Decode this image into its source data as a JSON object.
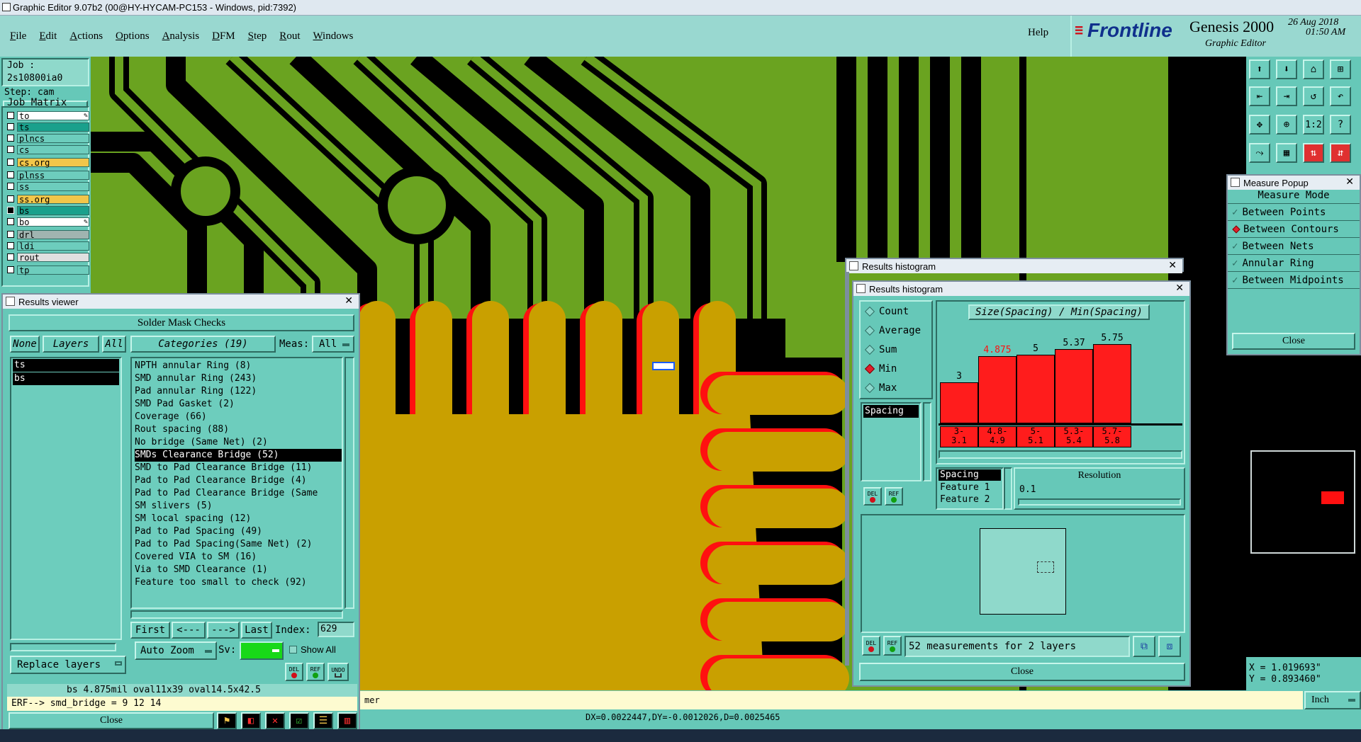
{
  "window_title": "Graphic Editor 9.07b2 (00@HY-HYCAM-PC153 - Windows, pid:7392)",
  "menu": [
    "File",
    "Edit",
    "Actions",
    "Options",
    "Analysis",
    "DFM",
    "Step",
    "Rout",
    "Windows"
  ],
  "help": "Help",
  "brand": {
    "logo": "Frontline",
    "product": "Genesis 2000",
    "subtitle": "Graphic Editor",
    "date": "26 Aug 2018",
    "time": "01:50 AM"
  },
  "job": {
    "job_label": "Job : 2s10800ia0",
    "step_label": "Step: cam",
    "matrix_button": "Job Matrix ..."
  },
  "layers": [
    {
      "name": "to",
      "color": "#ffffff",
      "mark": "✎"
    },
    {
      "name": "ts",
      "color": "#1aa08c",
      "mark": ""
    },
    {
      "name": "plncs",
      "color": "#6dcdbd",
      "mark": ""
    },
    {
      "name": "cs",
      "color": "#6dcdbd",
      "mark": ""
    },
    {
      "name": "cs.org",
      "color": "#f2c64a",
      "mark": ""
    },
    {
      "name": "plnss",
      "color": "#6dcdbd",
      "mark": ""
    },
    {
      "name": "ss",
      "color": "#6dcdbd",
      "mark": ""
    },
    {
      "name": "ss.org",
      "color": "#f2c64a",
      "mark": ""
    },
    {
      "name": "bs",
      "color": "#1aa08c",
      "mark": ""
    },
    {
      "name": "bo",
      "color": "#ffffff",
      "mark": "✎"
    },
    {
      "name": "drl",
      "color": "#a0b4b0",
      "mark": ""
    },
    {
      "name": "ldi",
      "color": "#6dcdbd",
      "mark": ""
    },
    {
      "name": "rout",
      "color": "#e0e0e0",
      "mark": ""
    },
    {
      "name": "tp",
      "color": "#6dcdbd",
      "mark": ""
    }
  ],
  "results_viewer": {
    "title": "Results viewer",
    "header": "Solder Mask Checks",
    "none_btn": "None",
    "layers_btn": "Layers",
    "all_btn": "All",
    "categories_btn": "Categories (19)",
    "meas_label": "Meas:",
    "meas_value": "All",
    "layer_list": [
      "ts",
      "bs"
    ],
    "categories": [
      "NPTH annular Ring (8)",
      "SMD annular Ring (243)",
      "Pad annular Ring (122)",
      "SMD Pad Gasket (2)",
      "Coverage (66)",
      "Rout spacing (88)",
      "No bridge (Same Net) (2)",
      "SMDs Clearance Bridge (52)",
      "SMD to Pad Clearance Bridge (11)",
      "Pad to Pad Clearance Bridge (4)",
      "Pad to Pad Clearance Bridge (Same",
      "SM slivers (5)",
      "SM local spacing (12)",
      "Pad to Pad Spacing (49)",
      "Pad to Pad Spacing(Same Net) (2)",
      "Covered VIA to SM (16)",
      "Via to SMD Clearance (1)",
      "Feature too small to check (92)"
    ],
    "selected_category": "SMDs Clearance Bridge (52)",
    "first": "First",
    "prev": "<---",
    "next": "--->",
    "last": "Last",
    "index_label": "Index:",
    "index_value": "629",
    "auto_zoom": "Auto Zoom",
    "sv_label": "Sv:",
    "show_all": "Show All",
    "replace_layers": "Replace layers",
    "del": "DEL",
    "ref": "REF",
    "undo": "UNDO",
    "status_line": "bs 4.875mil  oval11x39  oval14.5x42.5",
    "erf_line": "ERF--> smd_bridge = 9 12 14",
    "close": "Close"
  },
  "histogram": {
    "back_title": "Results histogram",
    "title": "Results histogram",
    "modes": [
      {
        "label": "Count",
        "on": false
      },
      {
        "label": "Average",
        "on": false
      },
      {
        "label": "Sum",
        "on": false
      },
      {
        "label": "Min",
        "on": true
      },
      {
        "label": "Max",
        "on": false
      }
    ],
    "chart_title": "Size(Spacing) / Min(Spacing)",
    "list_item": "Spacing",
    "attr_list": [
      "Spacing",
      "Feature 1",
      "Feature 2"
    ],
    "resolution_label": "Resolution",
    "resolution_value": "0.1",
    "summary": "52 measurements for 2 layers",
    "close": "Close",
    "del": "DEL",
    "ref": "REF"
  },
  "chart_data": {
    "type": "bar",
    "title": "Size(Spacing) / Min(Spacing)",
    "categories": [
      "3-\n3.1",
      "4.8-\n4.9",
      "5-\n5.1",
      "5.3-\n5.4",
      "5.7-\n5.8"
    ],
    "category_labels": [
      [
        "3-",
        "3.1"
      ],
      [
        "4.8-",
        "4.9"
      ],
      [
        "5-",
        "5.1"
      ],
      [
        "5.3-",
        "5.4"
      ],
      [
        "5.7-",
        "5.8"
      ]
    ],
    "values": [
      3,
      4.875,
      5,
      5.37,
      5.75
    ],
    "value_labels": [
      "3",
      "4.875",
      "5",
      "5.37",
      "5.75"
    ],
    "highlight_index": 1,
    "ylim": [
      0,
      5.75
    ]
  },
  "measure_popup": {
    "title": "Measure Popup",
    "header": "Measure Mode",
    "modes": [
      {
        "label": "Between Points",
        "on": false
      },
      {
        "label": "Between Contours",
        "on": true
      },
      {
        "label": "Between Nets",
        "on": false
      },
      {
        "label": "Annular Ring",
        "on": false
      },
      {
        "label": "Between Midpoints",
        "on": false
      }
    ],
    "close": "Close"
  },
  "coords": {
    "x": "X = 1.019693\"",
    "y": "Y = 0.893460\""
  },
  "units": "Inch",
  "message_bar": "mer",
  "delta_line": "DX=0.0022447,DY=-0.0012026,D=0.0025465",
  "zoom_button": "1:2",
  "colors": {
    "board": "#6aa320",
    "copper_black": "#000000",
    "pad": "#c9a000",
    "mask_red": "#ff1010",
    "panel": "#66c8b8"
  }
}
